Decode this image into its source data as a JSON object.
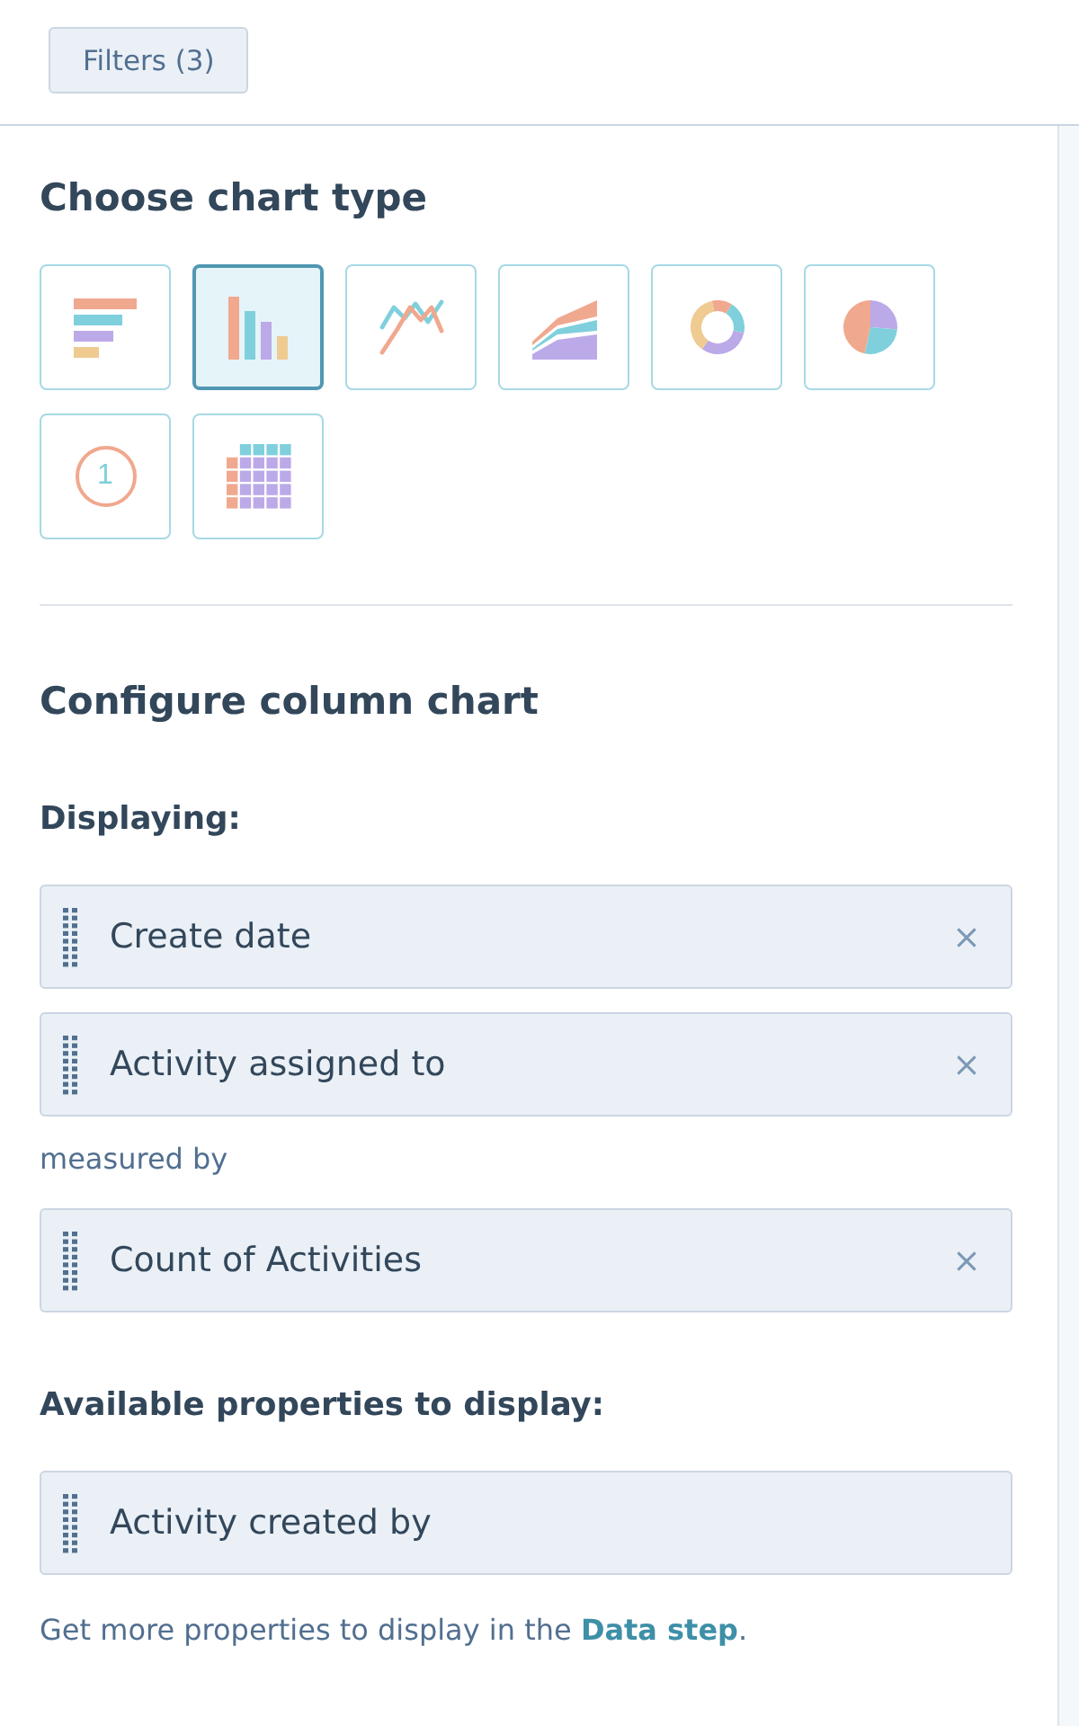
{
  "toolbar": {
    "filters_button": "Filters (3)"
  },
  "chart_types": {
    "title": "Choose chart type",
    "options": [
      {
        "kind": "horizontal_bar",
        "selected": false
      },
      {
        "kind": "column",
        "selected": true
      },
      {
        "kind": "line",
        "selected": false
      },
      {
        "kind": "area",
        "selected": false
      },
      {
        "kind": "donut",
        "selected": false
      },
      {
        "kind": "pie",
        "selected": false
      },
      {
        "kind": "single_value",
        "selected": false,
        "value": "1"
      },
      {
        "kind": "heatmap",
        "selected": false
      }
    ]
  },
  "configure": {
    "title": "Configure column chart",
    "sections": [
      {
        "kind": "heading",
        "label": "Displaying:",
        "properties": [
          {
            "label": "Create date",
            "removable": true
          },
          {
            "label": "Activity assigned to",
            "removable": true
          }
        ]
      },
      {
        "kind": "note",
        "label": "measured by",
        "properties": [
          {
            "label": "Count of Activities",
            "removable": true
          }
        ]
      },
      {
        "kind": "heading",
        "label": "Available properties to display:",
        "properties": [
          {
            "label": "Activity created by",
            "removable": false
          }
        ]
      }
    ],
    "help": {
      "before": "Get more properties to display in the ",
      "link": "Data step",
      "after": "."
    }
  }
}
